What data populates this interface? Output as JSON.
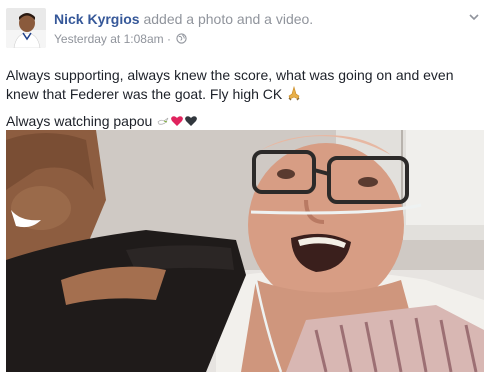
{
  "post": {
    "author": "Nick Kyrgios",
    "action": "added a photo and a video.",
    "timestamp": "Yesterday at 1:08am",
    "separator": "·",
    "privacy_icon": "globe-icon",
    "menu_icon": "chevron-down-icon",
    "text_line_1": "Always supporting, always knew the score, what was going on and even knew that Federer was the goat. Fly high CK",
    "text_line_1_emoji": "praying-hands-emoji",
    "text_line_2": "Always watching papou",
    "text_line_2_emojis": [
      "dove-emoji",
      "red-heart-emoji",
      "black-heart-emoji"
    ]
  },
  "colors": {
    "author_link": "#365899",
    "meta_gray": "#90949c",
    "text": "#1d2129",
    "red_heart": "#e0245e",
    "black_heart": "#31373d"
  }
}
